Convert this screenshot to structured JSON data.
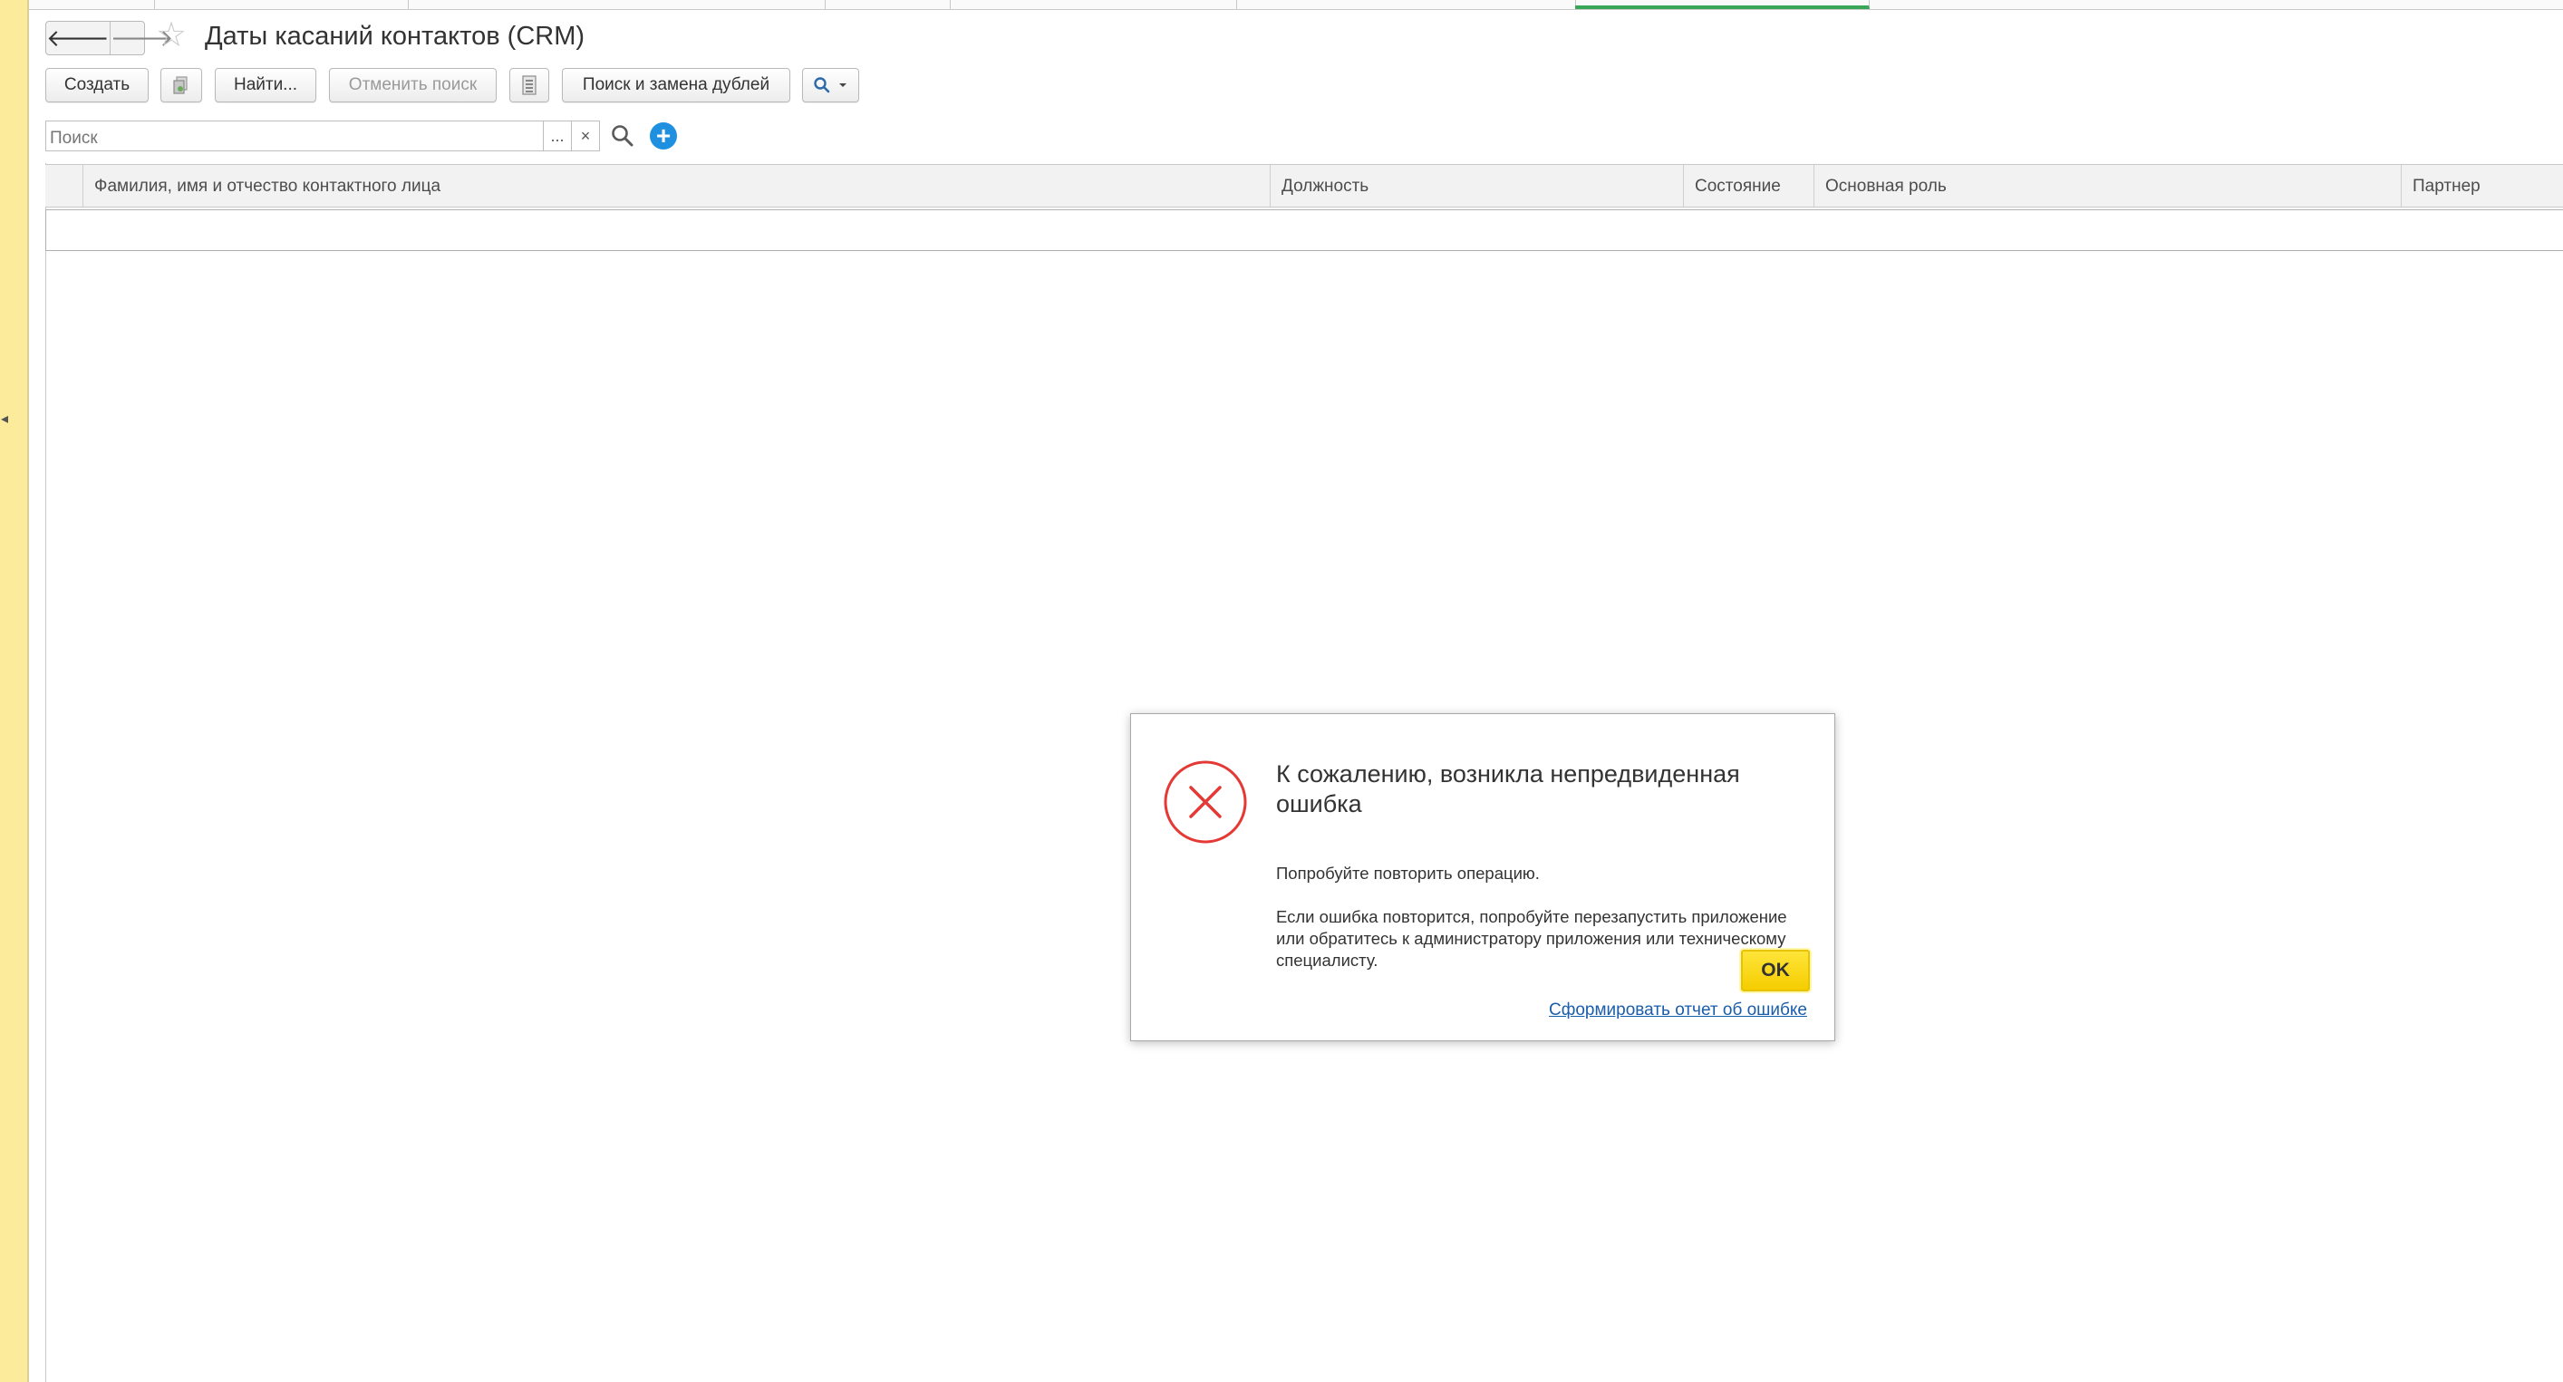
{
  "window": {
    "title": "Даты касаний контактов (CRM)"
  },
  "toolbar": {
    "create_label": "Создать",
    "find_label": "Найти...",
    "cancel_search_label": "Отменить поиск",
    "find_replace_dupes_label": "Поиск и замена дублей"
  },
  "search": {
    "placeholder": "Поиск",
    "select_label": "...",
    "clear_label": "×"
  },
  "table": {
    "columns": [
      "Фамилия, имя и отчество контактного лица",
      "Должность",
      "Состояние",
      "Основная роль",
      "Партнер"
    ]
  },
  "dialog": {
    "title": "К сожалению, возникла непредвиденная ошибка",
    "message_line1": "Попробуйте повторить операцию.",
    "message_line2": "Если ошибка повторится, попробуйте перезапустить приложение или обратитесь к администратору приложения или техническому специалисту.",
    "ok_label": "OK",
    "report_link": "Сформировать отчет об ошибке"
  },
  "colors": {
    "left_panel": "#fdeb9c",
    "active_tab": "#3aa657",
    "ok_button": "#f5cd00",
    "error_icon": "#e53935",
    "add_icon": "#1f8fe0",
    "link": "#1a5dab"
  },
  "icons": {
    "back": "arrow-left-icon",
    "forward": "arrow-right-icon",
    "favorite": "star-icon",
    "copy": "copy-icon",
    "list": "list-icon",
    "search": "search-icon",
    "add": "plus-circle-icon",
    "error": "error-circle-icon"
  }
}
